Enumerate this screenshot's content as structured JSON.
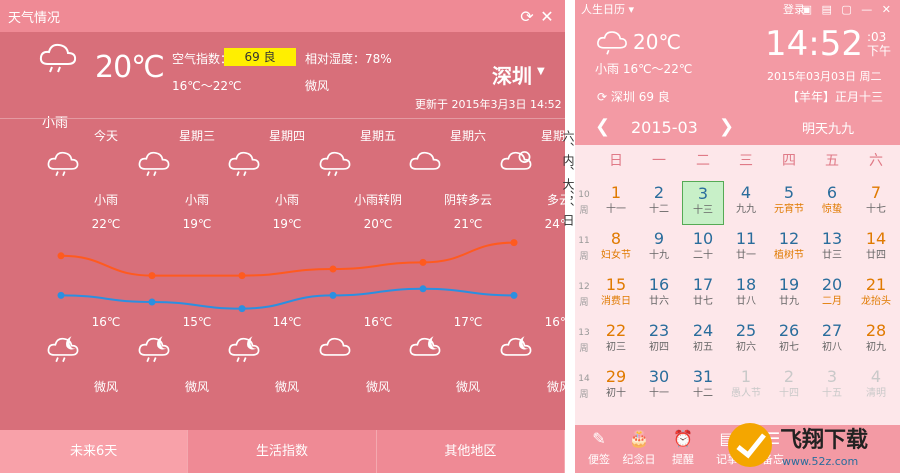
{
  "weather": {
    "title": "天气情况",
    "current": {
      "condition": "小雨",
      "temp": "20℃",
      "aq_label": "空气指数：",
      "aq_value": "69 良",
      "humidity": "相对湿度：78%",
      "range": "16℃～22℃",
      "wind": "微风",
      "city": "深圳",
      "update": "更新于 2015年3月3日 14:52"
    },
    "forecast": [
      {
        "day": "今天",
        "cond": "小雨",
        "hi": "22℃",
        "lo": "16℃",
        "wind": "微风",
        "icon_day": "cloud-rain-icon",
        "icon_night": "moon-cloud-rain-icon"
      },
      {
        "day": "星期三",
        "cond": "小雨",
        "hi": "19℃",
        "lo": "15℃",
        "wind": "微风",
        "icon_day": "cloud-rain-icon",
        "icon_night": "moon-cloud-rain-icon"
      },
      {
        "day": "星期四",
        "cond": "小雨",
        "hi": "19℃",
        "lo": "14℃",
        "wind": "微风",
        "icon_day": "cloud-rain-icon",
        "icon_night": "moon-cloud-rain-icon"
      },
      {
        "day": "星期五",
        "cond": "小雨转阴",
        "hi": "20℃",
        "lo": "16℃",
        "wind": "微风",
        "icon_day": "cloud-rain-icon",
        "icon_night": "cloud-icon"
      },
      {
        "day": "星期六",
        "cond": "阴转多云",
        "hi": "21℃",
        "lo": "17℃",
        "wind": "微风",
        "icon_day": "cloud-icon",
        "icon_night": "moon-cloud-icon"
      },
      {
        "day": "星期日",
        "cond": "多云",
        "hi": "24℃",
        "lo": "16℃",
        "wind": "微风",
        "icon_day": "sun-cloud-icon",
        "icon_night": "moon-cloud-icon"
      }
    ],
    "tabs": [
      "未来6天",
      "生活指数",
      "其他地区"
    ],
    "colors": {
      "hi_line": "#ff5a1f",
      "lo_line": "#2c8fe0",
      "aq_badge": "#ffef00"
    }
  },
  "chart_data": {
    "type": "line",
    "categories": [
      "今天",
      "星期三",
      "星期四",
      "星期五",
      "星期六",
      "星期日"
    ],
    "series": [
      {
        "values": [
          22,
          19,
          19,
          20,
          21,
          24
        ]
      },
      {
        "values": [
          16,
          15,
          14,
          16,
          17,
          16
        ]
      }
    ]
  },
  "gap_text": "六、内、大、，、日",
  "calendar": {
    "app_title": "人生日历 ▾",
    "login": "登录",
    "cur_temp": "20℃",
    "cur_range": "小雨 16℃～22℃",
    "time": "14:52",
    "seconds": ":03",
    "ampm": "下午",
    "date": "2015年03月03日 周二",
    "aq": "深圳 69 良",
    "lunar_year": "【羊年】正月十三",
    "month": "2015-03",
    "today_btn": "明天九九",
    "weekdays": [
      "日",
      "一",
      "二",
      "三",
      "四",
      "五",
      "六"
    ],
    "week_nums": [
      "10",
      "11",
      "12",
      "13",
      "14"
    ],
    "week_suffix": "周",
    "rows": [
      [
        [
          "1",
          "十一"
        ],
        [
          "2",
          "十二"
        ],
        [
          "3",
          "十三"
        ],
        [
          "4",
          "九九"
        ],
        [
          "5",
          "元宵节"
        ],
        [
          "6",
          "惊蛰"
        ],
        [
          "7",
          "十七"
        ]
      ],
      [
        [
          "8",
          "妇女节"
        ],
        [
          "9",
          "十九"
        ],
        [
          "10",
          "二十"
        ],
        [
          "11",
          "廿一"
        ],
        [
          "12",
          "植树节"
        ],
        [
          "13",
          "廿三"
        ],
        [
          "14",
          "廿四"
        ]
      ],
      [
        [
          "15",
          "消费日"
        ],
        [
          "16",
          "廿六"
        ],
        [
          "17",
          "廿七"
        ],
        [
          "18",
          "廿八"
        ],
        [
          "19",
          "廿九"
        ],
        [
          "20",
          "二月"
        ],
        [
          "21",
          "龙抬头"
        ]
      ],
      [
        [
          "22",
          "初三"
        ],
        [
          "23",
          "初四"
        ],
        [
          "24",
          "初五"
        ],
        [
          "25",
          "初六"
        ],
        [
          "26",
          "初七"
        ],
        [
          "27",
          "初八"
        ],
        [
          "28",
          "初九"
        ]
      ],
      [
        [
          "29",
          "初十"
        ],
        [
          "30",
          "十一"
        ],
        [
          "31",
          "十二"
        ],
        [
          "1",
          "愚人节"
        ],
        [
          "2",
          "十四"
        ],
        [
          "3",
          "十五"
        ],
        [
          "4",
          "清明"
        ]
      ]
    ],
    "bottom_buttons": [
      "便签",
      "纪念日",
      "提醒",
      "记事",
      "备忘"
    ],
    "watermark": "飞翔下载",
    "watermark_url": "www.52z.com"
  }
}
